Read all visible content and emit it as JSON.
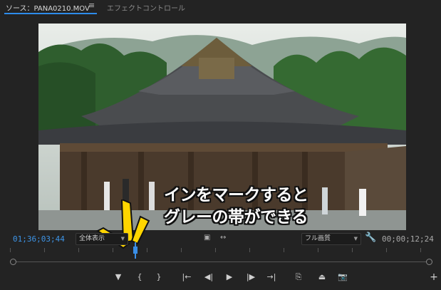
{
  "tabs": [
    {
      "label": "ソース：PANA0210.MOV",
      "menu_icon": "≡"
    },
    {
      "label": "エフェクトコントロール"
    }
  ],
  "caption": {
    "line1": "インをマークすると",
    "line2": "グレーの帯ができる"
  },
  "timecode": {
    "in": "01;36;03;44",
    "duration": "00;00;12;24"
  },
  "fit_dropdown": {
    "value": "全体表示"
  },
  "resolution_dropdown": {
    "value": "フル画質"
  },
  "mid_icons": [
    "▣",
    "↔"
  ],
  "wrench_icon": "🔧",
  "controls": [
    {
      "name": "add-marker-button",
      "glyph": "▼"
    },
    {
      "name": "mark-in-button",
      "glyph": "{"
    },
    {
      "name": "mark-out-button",
      "glyph": "}"
    },
    {
      "name": "go-to-in-button",
      "glyph": "|←"
    },
    {
      "name": "step-back-button",
      "glyph": "◀|"
    },
    {
      "name": "play-button",
      "glyph": "▶"
    },
    {
      "name": "step-forward-button",
      "glyph": "|▶"
    },
    {
      "name": "go-to-out-button",
      "glyph": "→|"
    },
    {
      "name": "insert-button",
      "glyph": "⎘"
    },
    {
      "name": "overwrite-button",
      "glyph": "⏏"
    },
    {
      "name": "export-frame-button",
      "glyph": "📷"
    }
  ],
  "add_button": "+",
  "colors": {
    "accent": "#2d8ceb",
    "panel": "#232323"
  }
}
